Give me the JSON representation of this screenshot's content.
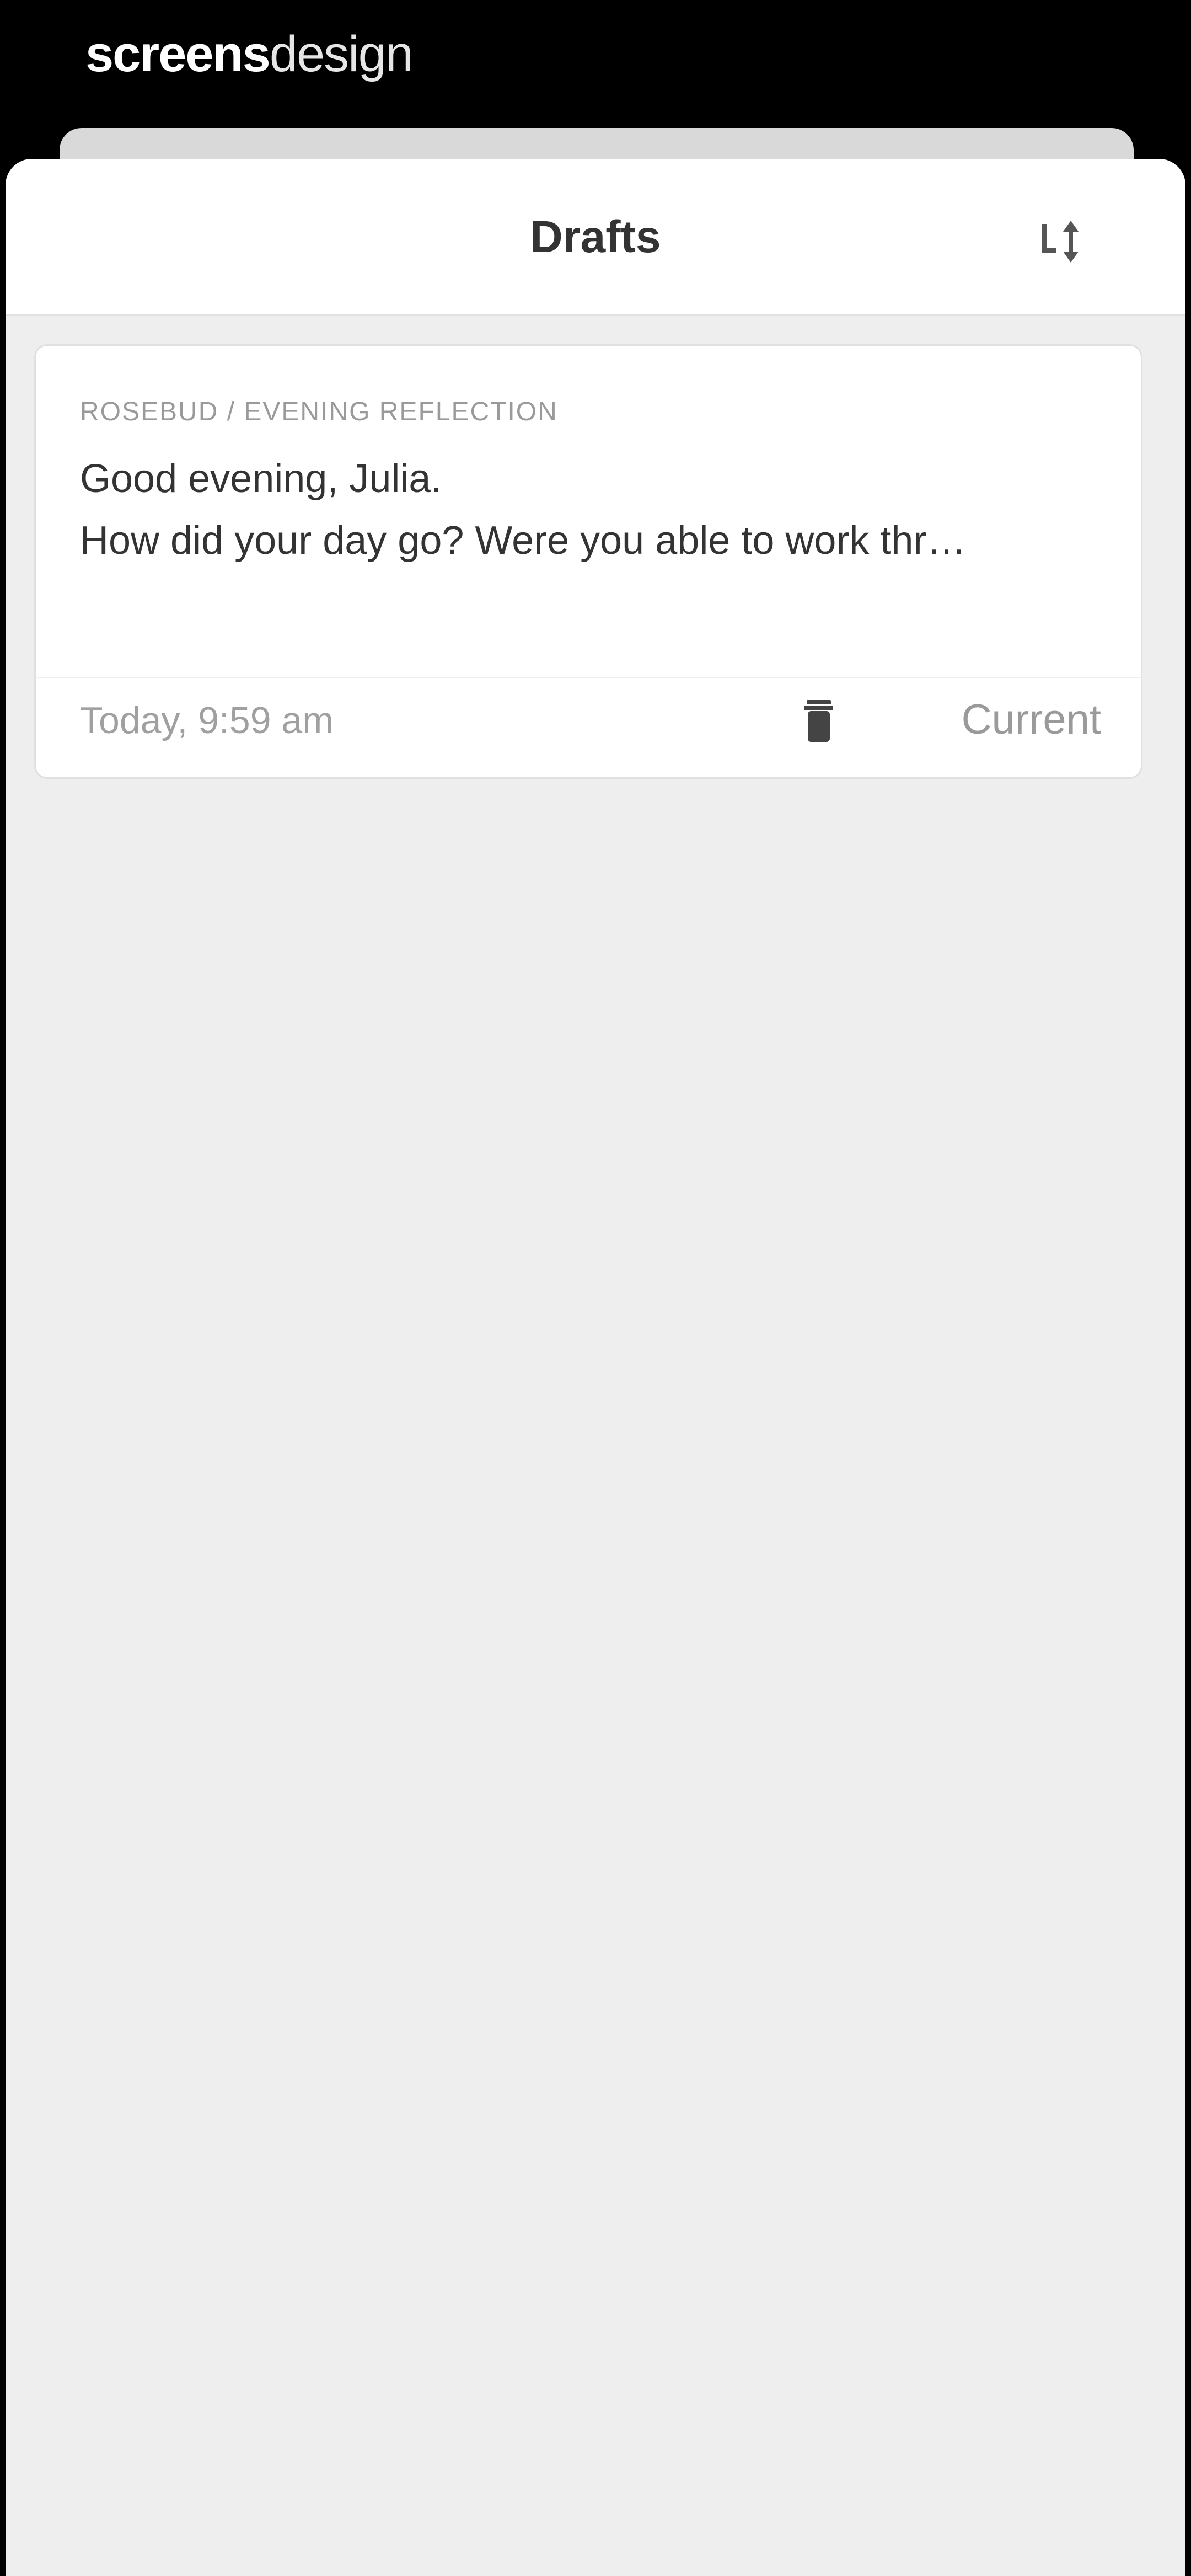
{
  "watermark": {
    "bold_part": "screens",
    "light_part": "design"
  },
  "header": {
    "title": "Drafts",
    "sort_icon": "sort-icon"
  },
  "drafts": [
    {
      "meta": "ROSEBUD / EVENING REFLECTION",
      "body_line_1": "Good evening, Julia.",
      "body_line_2": "How did your day go? Were you able to work thr…",
      "timestamp": "Today, 9:59 am",
      "delete_icon": "trash-icon",
      "status": "Current"
    }
  ],
  "colors": {
    "background": "#eeeeee",
    "card": "#ffffff",
    "title_text": "#333333",
    "muted_text": "#9a9a9a"
  }
}
